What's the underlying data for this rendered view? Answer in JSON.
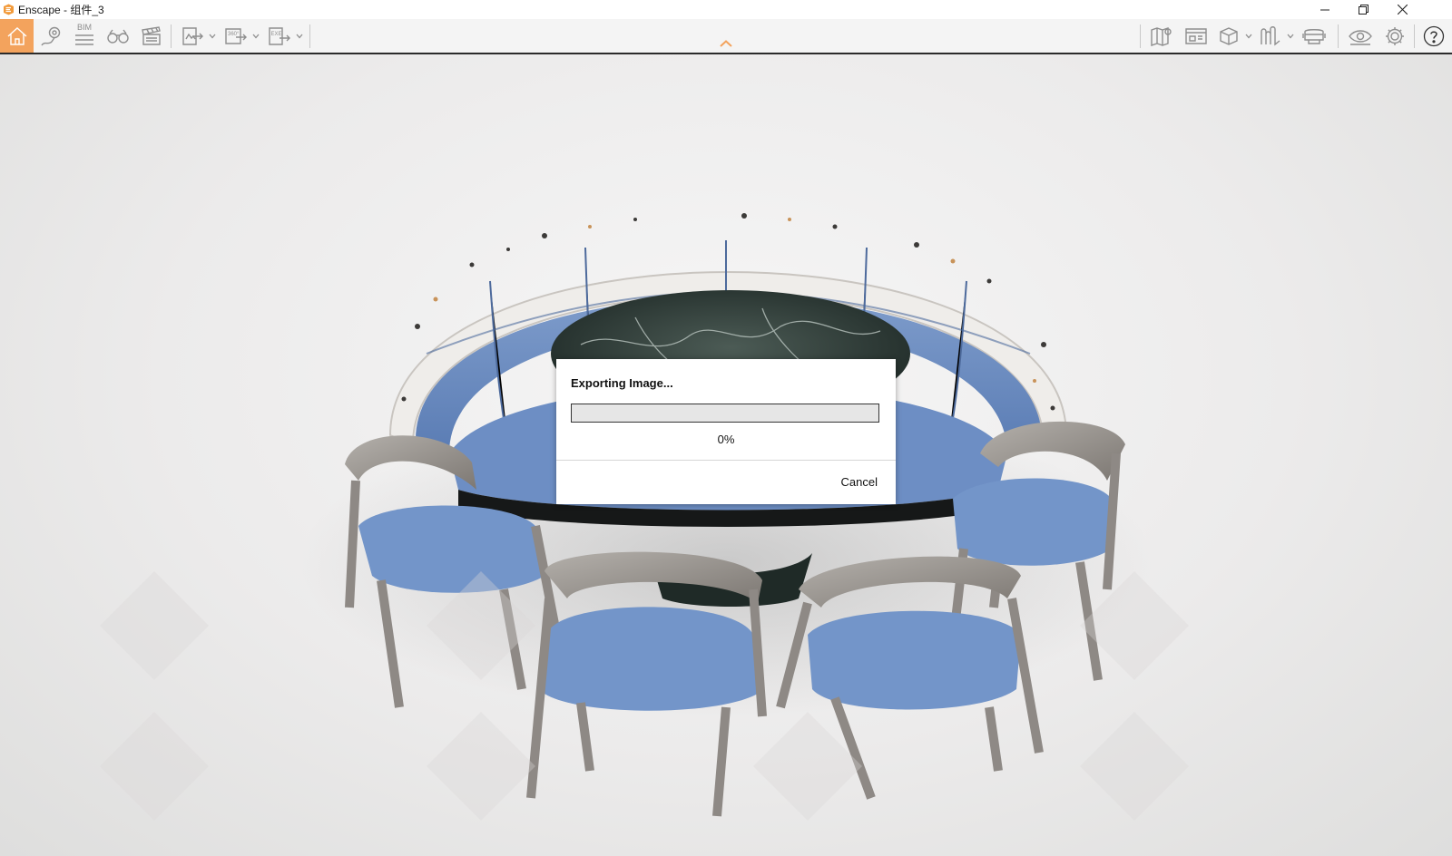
{
  "window": {
    "title": "Enscape - 组件_3",
    "app_icon": "enscape-logo-icon",
    "controls": [
      "minimize-icon",
      "restore-icon",
      "close-icon"
    ]
  },
  "toolbar": {
    "left_groups": [
      [
        "home-icon",
        "map-pin-icon",
        "bim-icon",
        "binoculars-icon",
        "clapperboard-icon"
      ],
      [
        "export-image-icon",
        "export-panorama-icon",
        "export-exe-icon"
      ]
    ],
    "bim_label": "BIM",
    "panorama_label": "360°",
    "exe_label": "EXE",
    "right_groups": [
      [
        "map-icon",
        "asset-library-icon",
        "cube-views-icon",
        "sun-shadow-icon",
        "vr-headset-icon"
      ],
      [
        "visibility-eye-icon",
        "settings-gear-icon"
      ],
      [
        "help-icon"
      ]
    ],
    "active_item": "home-icon",
    "accent_color": "#f3a35d",
    "collapse_icon": "chevron-up-icon"
  },
  "dialog": {
    "title": "Exporting Image...",
    "progress_fraction": 0,
    "progress_text": "0%",
    "cancel_label": "Cancel"
  }
}
